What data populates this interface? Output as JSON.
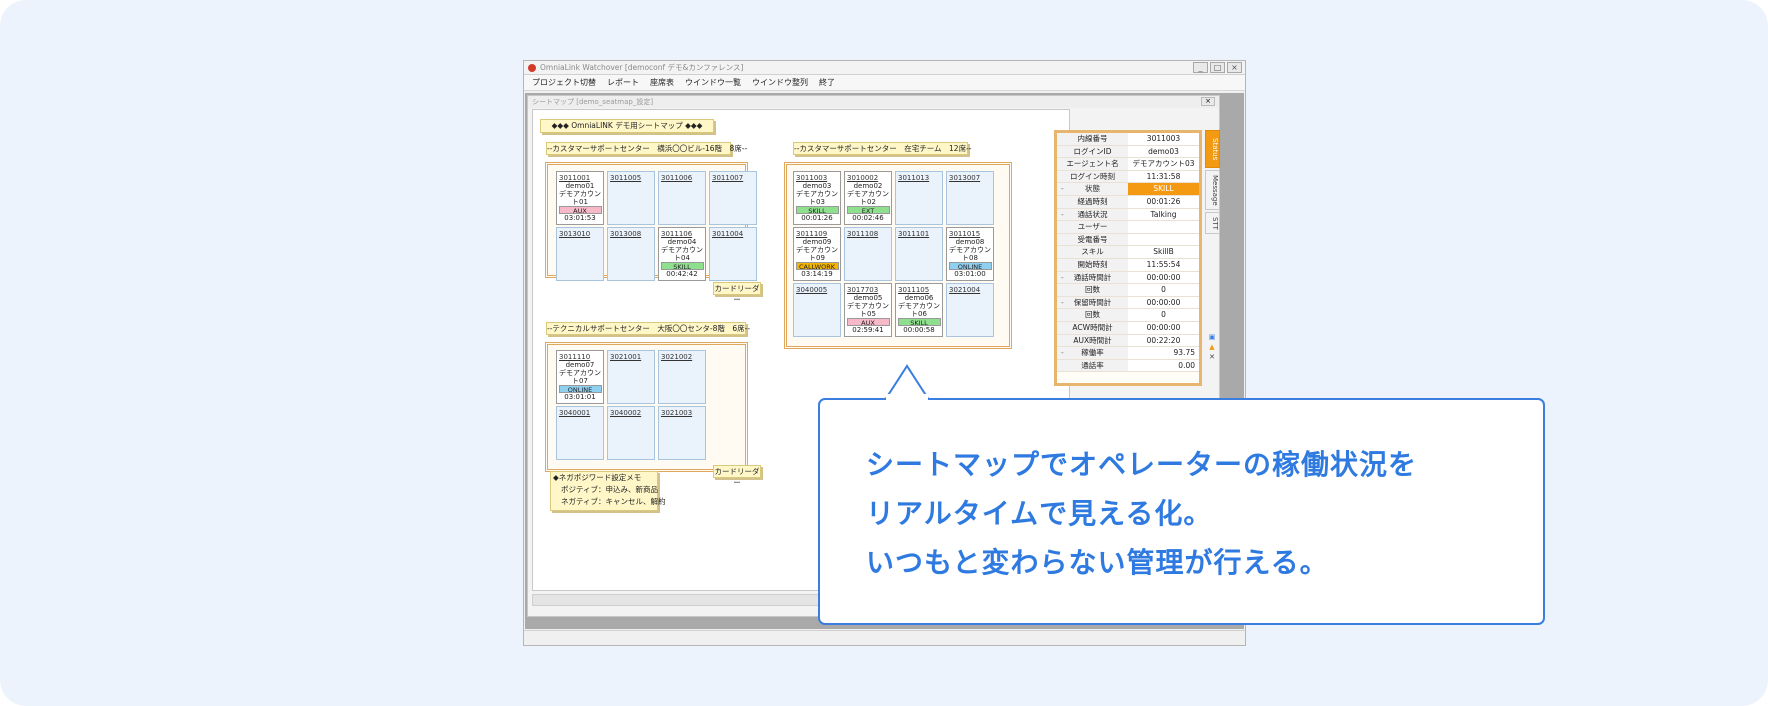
{
  "window": {
    "title": "OmniaLink Watchover [democonf デモ&カンファレンス]",
    "buttons": [
      "_",
      "□",
      "×"
    ]
  },
  "menu": [
    "プロジェクト切替",
    "レポート",
    "座席表",
    "ウインドウ一覧",
    "ウインドウ整列",
    "終了"
  ],
  "child_window": {
    "title": "シートマップ [demo_seatmap_設定]",
    "close": "×"
  },
  "map_title": "◆◆◆ OmniaLINK デモ用シートマップ ◆◆◆",
  "groups": [
    {
      "label": "--カスタマーサポートセンター　横浜〇〇ビル-16階　8席--",
      "reader": "カードリーダー",
      "seats": [
        {
          "ext": "3011001",
          "user": "demo01",
          "agent": "デモアカウント01",
          "status": "AUX",
          "time": "03:01:53"
        },
        {
          "ext": "3011005"
        },
        {
          "ext": "3011006"
        },
        {
          "ext": "3011007"
        },
        {
          "ext": "3013010"
        },
        {
          "ext": "3013008"
        },
        {
          "ext": "3011106",
          "user": "demo04",
          "agent": "デモアカウント04",
          "status": "SKILL",
          "time": "00:42:42"
        },
        {
          "ext": "3011004"
        }
      ]
    },
    {
      "label": "--カスタマーサポートセンター　在宅チーム　12席--",
      "seats": [
        {
          "ext": "3011003",
          "user": "demo03",
          "agent": "デモアカウント03",
          "status": "SKILL",
          "time": "00:01:26"
        },
        {
          "ext": "3010002",
          "user": "demo02",
          "agent": "デモアカウント02",
          "status": "EXT",
          "time": "00:02:46"
        },
        {
          "ext": "3011013"
        },
        {
          "ext": "3013007"
        },
        {
          "ext": "3011109",
          "user": "demo09",
          "agent": "デモアカウント09",
          "status": "CALLWORK",
          "time": "03:14:19"
        },
        {
          "ext": "3011108"
        },
        {
          "ext": "3011101"
        },
        {
          "ext": "3011015",
          "user": "demo08",
          "agent": "デモアカウント08",
          "status": "ONLINE",
          "time": "03:01:00"
        },
        {
          "ext": "3040005"
        },
        {
          "ext": "3017703",
          "user": "demo05",
          "agent": "デモアカウント05",
          "status": "AUX",
          "time": "02:59:41"
        },
        {
          "ext": "3011105",
          "user": "demo06",
          "agent": "デモアカウント06",
          "status": "SKILL",
          "time": "00:00:58"
        },
        {
          "ext": "3021004"
        }
      ]
    },
    {
      "label": "--テクニカルサポートセンター　大阪〇〇センタ-8階　6席--",
      "reader": "カードリーダー",
      "seats": [
        {
          "ext": "3011110",
          "user": "demo07",
          "agent": "デモアカウント07",
          "status": "ONLINE",
          "time": "03:01:01"
        },
        {
          "ext": "3021001"
        },
        {
          "ext": "3021002"
        },
        {
          "ext": "3040001"
        },
        {
          "ext": "3040002"
        },
        {
          "ext": "3021003"
        }
      ]
    }
  ],
  "memo": [
    "◆ネガポジワード設定メモ",
    "ポジティブ：申込み、新商品",
    "ネガティブ：キャンセル、解約"
  ],
  "panel": [
    {
      "k": "内線番号",
      "v": "3011003"
    },
    {
      "k": "ログインID",
      "v": "demo03"
    },
    {
      "k": "エージェント名",
      "v": "デモアカウント03"
    },
    {
      "k": "ログイン時刻",
      "v": "11:31:58"
    },
    {
      "k": "状態",
      "v": "SKILL",
      "ex": "-",
      "hl": true
    },
    {
      "k": "経過時刻",
      "v": "00:01:26"
    },
    {
      "k": "通話状況",
      "v": "Talking",
      "ex": "-"
    },
    {
      "k": "ユーザー",
      "v": ""
    },
    {
      "k": "受電番号",
      "v": ""
    },
    {
      "k": "スキル",
      "v": "SkillB"
    },
    {
      "k": "開始時刻",
      "v": "11:55:54"
    },
    {
      "k": "通話時間計",
      "v": "00:00:00",
      "ex": "-"
    },
    {
      "k": "回数",
      "v": "0"
    },
    {
      "k": "保留時間計",
      "v": "00:00:00",
      "ex": "-"
    },
    {
      "k": "回数",
      "v": "0"
    },
    {
      "k": "ACW時間計",
      "v": "00:00:00"
    },
    {
      "k": "AUX時間計",
      "v": "00:22:20"
    },
    {
      "k": "稼働率",
      "v": "93.75",
      "ex": "-",
      "right": true
    },
    {
      "k": "通話率",
      "v": "0.00",
      "right": true
    }
  ],
  "tabs": [
    "Status",
    "Message",
    "STT"
  ],
  "callout": {
    "lines": [
      "シートマップでオペレーターの稼働状況を",
      "リアルタイムで見える化。",
      "いつもと変わらない管理が行える。"
    ]
  },
  "colors": {
    "accent": "#2f7ae0",
    "skill": "#f39a12",
    "frame": "#e0a85e"
  }
}
